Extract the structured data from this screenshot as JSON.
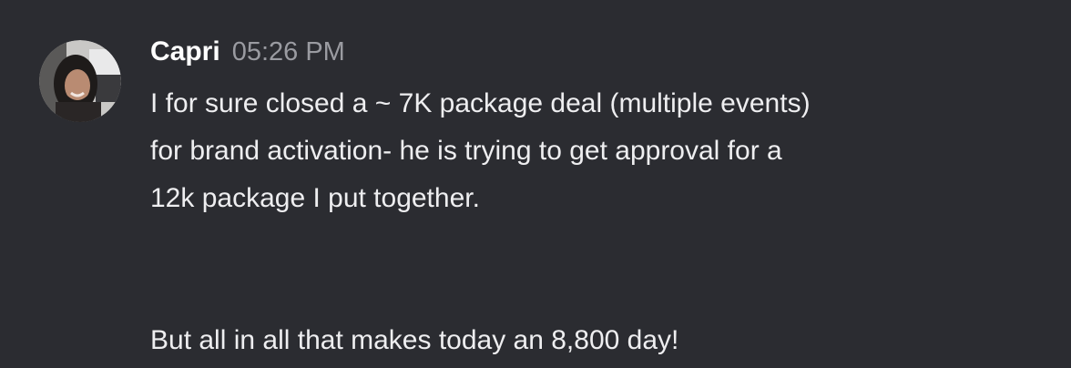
{
  "message": {
    "author": "Capri",
    "timestamp": "05:26 PM",
    "paragraphs": [
      "I for sure closed a ~ 7K package deal (multiple events)\nfor brand activation- he is trying to get approval for a\n12k package I put together.",
      "But all in all that makes today an 8,800 day!"
    ]
  },
  "colors": {
    "background": "#2b2c31",
    "author": "#ffffff",
    "timestamp": "#9a9ba1",
    "text": "#eeeef0"
  }
}
